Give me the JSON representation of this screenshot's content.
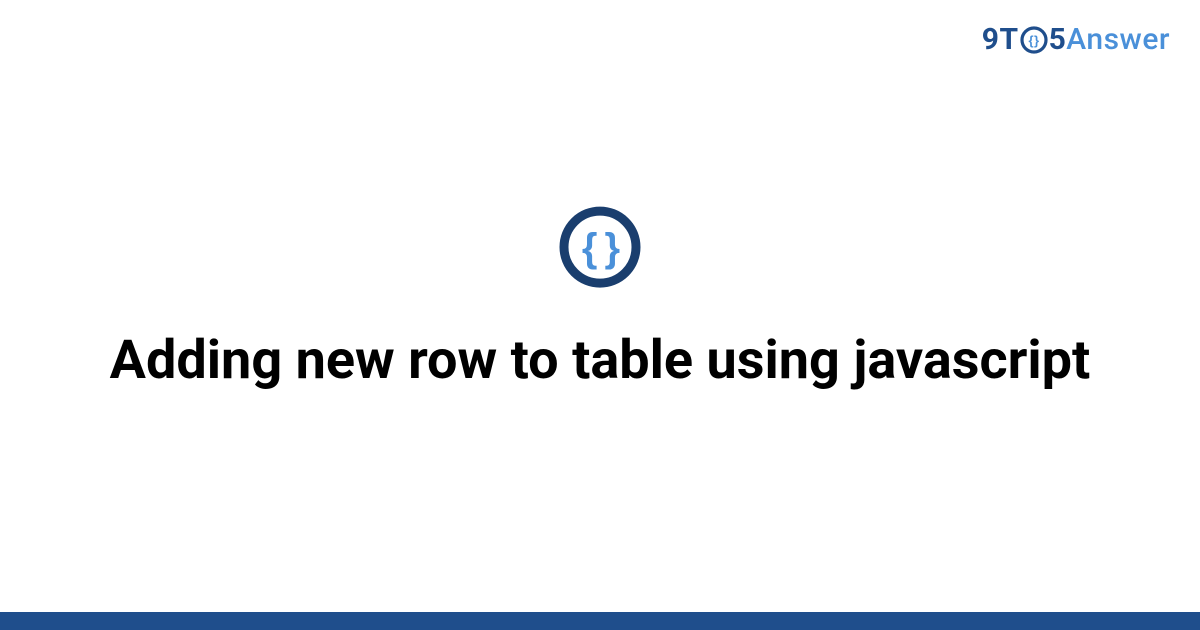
{
  "brand": {
    "nine": "9",
    "t": "T",
    "five": "5",
    "answer": "Answer"
  },
  "main": {
    "title": "Adding new row to table using javascript"
  },
  "topic_icon": "code-braces-icon",
  "colors": {
    "brand_dark": "#1f4e8c",
    "brand_light": "#4a90d9",
    "icon_ring": "#1a3e6e",
    "icon_inner": "#4a90d9",
    "bottom_bar": "#1f4e8c"
  }
}
